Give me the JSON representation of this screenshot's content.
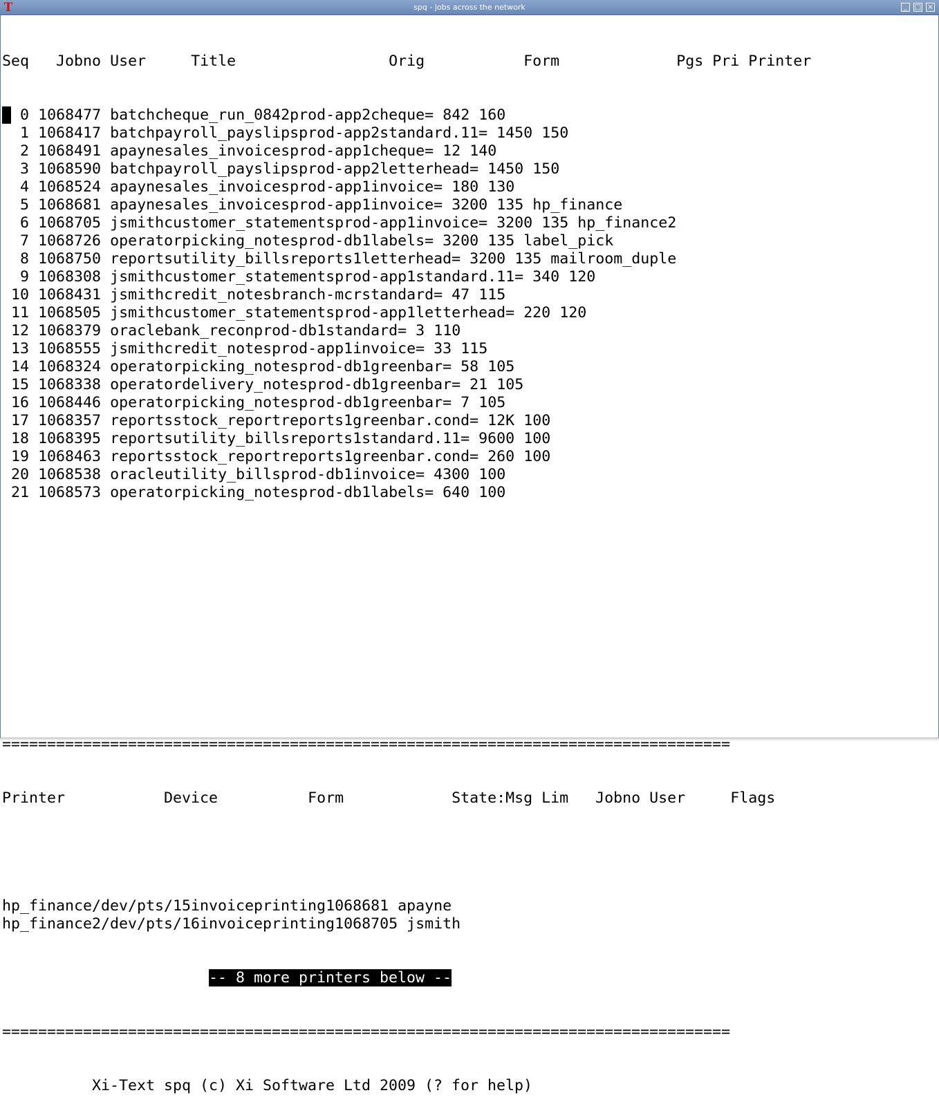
{
  "window": {
    "title": "spq - jobs across the network",
    "icon": "xi-t-icon",
    "buttons": [
      "minimize",
      "maximize",
      "close"
    ]
  },
  "jobs": {
    "header": {
      "seq": "Seq",
      "jobno": "Jobno",
      "user": "User",
      "title": "Title",
      "orig": "Orig",
      "form": "Form",
      "pgs": "Pgs",
      "pri": "Pri",
      "printer": "Printer"
    },
    "rows": [
      {
        "seq": "0",
        "jobno": "1068477",
        "user": "batch",
        "title": "cheque_run_0842",
        "orig": "prod-app2",
        "form": "cheque",
        "eq": "=",
        "pgs": "842",
        "pri": "160",
        "printer": ""
      },
      {
        "seq": "1",
        "jobno": "1068417",
        "user": "batch",
        "title": "payroll_payslips",
        "orig": "prod-app2",
        "form": "standard.11",
        "eq": "=",
        "pgs": "1450",
        "pri": "150",
        "printer": ""
      },
      {
        "seq": "2",
        "jobno": "1068491",
        "user": "apayne",
        "title": "sales_invoices",
        "orig": "prod-app1",
        "form": "cheque",
        "eq": "=",
        "pgs": "12",
        "pri": "140",
        "printer": ""
      },
      {
        "seq": "3",
        "jobno": "1068590",
        "user": "batch",
        "title": "payroll_payslips",
        "orig": "prod-app2",
        "form": "letterhead",
        "eq": "=",
        "pgs": "1450",
        "pri": "150",
        "printer": ""
      },
      {
        "seq": "4",
        "jobno": "1068524",
        "user": "apayne",
        "title": "sales_invoices",
        "orig": "prod-app1",
        "form": "invoice",
        "eq": "=",
        "pgs": "180",
        "pri": "130",
        "printer": ""
      },
      {
        "seq": "5",
        "jobno": "1068681",
        "user": "apayne",
        "title": "sales_invoices",
        "orig": "prod-app1",
        "form": "invoice",
        "eq": "=",
        "pgs": "3200",
        "pri": "135",
        "printer": "hp_finance"
      },
      {
        "seq": "6",
        "jobno": "1068705",
        "user": "jsmith",
        "title": "customer_statements",
        "orig": "prod-app1",
        "form": "invoice",
        "eq": "=",
        "pgs": "3200",
        "pri": "135",
        "printer": "hp_finance2"
      },
      {
        "seq": "7",
        "jobno": "1068726",
        "user": "operator",
        "title": "picking_notes",
        "orig": "prod-db1",
        "form": "labels",
        "eq": "=",
        "pgs": "3200",
        "pri": "135",
        "printer": "label_pick"
      },
      {
        "seq": "8",
        "jobno": "1068750",
        "user": "reports",
        "title": "utility_bills",
        "orig": "reports1",
        "form": "letterhead",
        "eq": "=",
        "pgs": "3200",
        "pri": "135",
        "printer": "mailroom_duple"
      },
      {
        "seq": "9",
        "jobno": "1068308",
        "user": "jsmith",
        "title": "customer_statements",
        "orig": "prod-app1",
        "form": "standard.11",
        "eq": "=",
        "pgs": "340",
        "pri": "120",
        "printer": ""
      },
      {
        "seq": "10",
        "jobno": "1068431",
        "user": "jsmith",
        "title": "credit_notes",
        "orig": "branch-mcr",
        "form": "standard",
        "eq": "=",
        "pgs": "47",
        "pri": "115",
        "printer": ""
      },
      {
        "seq": "11",
        "jobno": "1068505",
        "user": "jsmith",
        "title": "customer_statements",
        "orig": "prod-app1",
        "form": "letterhead",
        "eq": "=",
        "pgs": "220",
        "pri": "120",
        "printer": ""
      },
      {
        "seq": "12",
        "jobno": "1068379",
        "user": "oracle",
        "title": "bank_recon",
        "orig": "prod-db1",
        "form": "standard",
        "eq": "=",
        "pgs": "3",
        "pri": "110",
        "printer": ""
      },
      {
        "seq": "13",
        "jobno": "1068555",
        "user": "jsmith",
        "title": "credit_notes",
        "orig": "prod-app1",
        "form": "invoice",
        "eq": "=",
        "pgs": "33",
        "pri": "115",
        "printer": ""
      },
      {
        "seq": "14",
        "jobno": "1068324",
        "user": "operator",
        "title": "picking_notes",
        "orig": "prod-db1",
        "form": "greenbar",
        "eq": "=",
        "pgs": "58",
        "pri": "105",
        "printer": ""
      },
      {
        "seq": "15",
        "jobno": "1068338",
        "user": "operator",
        "title": "delivery_notes",
        "orig": "prod-db1",
        "form": "greenbar",
        "eq": "=",
        "pgs": "21",
        "pri": "105",
        "printer": ""
      },
      {
        "seq": "16",
        "jobno": "1068446",
        "user": "operator",
        "title": "picking_notes",
        "orig": "prod-db1",
        "form": "greenbar",
        "eq": "=",
        "pgs": "7",
        "pri": "105",
        "printer": ""
      },
      {
        "seq": "17",
        "jobno": "1068357",
        "user": "reports",
        "title": "stock_report",
        "orig": "reports1",
        "form": "greenbar.cond",
        "eq": "=",
        "pgs": "12K",
        "pri": "100",
        "printer": ""
      },
      {
        "seq": "18",
        "jobno": "1068395",
        "user": "reports",
        "title": "utility_bills",
        "orig": "reports1",
        "form": "standard.11",
        "eq": "=",
        "pgs": "9600",
        "pri": "100",
        "printer": ""
      },
      {
        "seq": "19",
        "jobno": "1068463",
        "user": "reports",
        "title": "stock_report",
        "orig": "reports1",
        "form": "greenbar.cond",
        "eq": "=",
        "pgs": "260",
        "pri": "100",
        "printer": ""
      },
      {
        "seq": "20",
        "jobno": "1068538",
        "user": "oracle",
        "title": "utility_bills",
        "orig": "prod-db1",
        "form": "invoice",
        "eq": "=",
        "pgs": "4300",
        "pri": "100",
        "printer": ""
      },
      {
        "seq": "21",
        "jobno": "1068573",
        "user": "operator",
        "title": "picking_notes",
        "orig": "prod-db1",
        "form": "labels",
        "eq": "=",
        "pgs": "640",
        "pri": "100",
        "printer": ""
      }
    ]
  },
  "separator": "=================================================================================",
  "printers": {
    "header": {
      "printer": "Printer",
      "device": "Device",
      "form": "Form",
      "state": "State:Msg Lim",
      "jobno": "Jobno",
      "user": "User",
      "flags": "Flags"
    },
    "rows": [
      {
        "printer": "hp_finance",
        "device": "/dev/pts/15",
        "form": "invoice",
        "state": "printing",
        "jobno": "1068681",
        "user": "apayne",
        "flags": ""
      },
      {
        "printer": "hp_finance2",
        "device": "/dev/pts/16",
        "form": "invoice",
        "state": "printing",
        "jobno": "1068705",
        "user": "jsmith",
        "flags": ""
      }
    ],
    "more_notice": "-- 8 more printers below --"
  },
  "footer": "Xi-Text spq (c) Xi Software Ltd 2009 (? for help)",
  "colors": {
    "titlebar": "#7a97c2",
    "text": "#000000",
    "background": "#ffffff",
    "highlight": "#000000"
  }
}
